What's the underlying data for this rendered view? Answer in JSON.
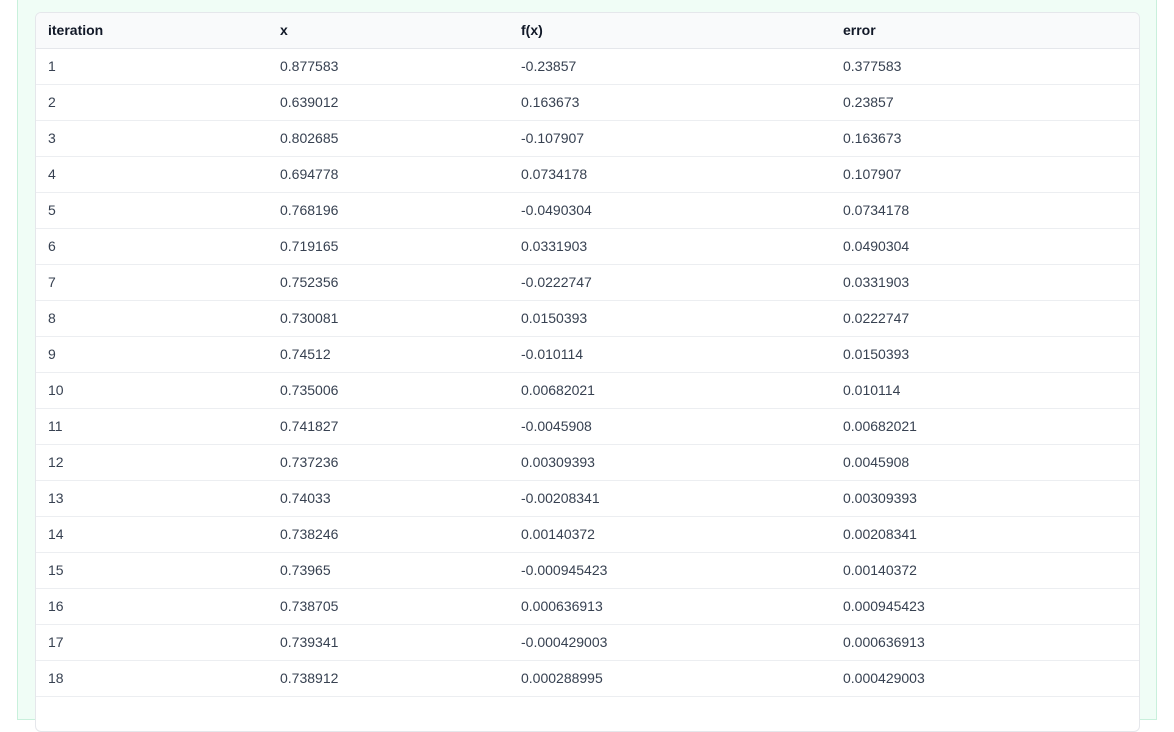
{
  "table": {
    "columns": [
      "iteration",
      "x",
      "f(x)",
      "error"
    ],
    "rows": [
      [
        "1",
        "0.877583",
        "-0.23857",
        "0.377583"
      ],
      [
        "2",
        "0.639012",
        "0.163673",
        "0.23857"
      ],
      [
        "3",
        "0.802685",
        "-0.107907",
        "0.163673"
      ],
      [
        "4",
        "0.694778",
        "0.0734178",
        "0.107907"
      ],
      [
        "5",
        "0.768196",
        "-0.0490304",
        "0.0734178"
      ],
      [
        "6",
        "0.719165",
        "0.0331903",
        "0.0490304"
      ],
      [
        "7",
        "0.752356",
        "-0.0222747",
        "0.0331903"
      ],
      [
        "8",
        "0.730081",
        "0.0150393",
        "0.0222747"
      ],
      [
        "9",
        "0.74512",
        "-0.010114",
        "0.0150393"
      ],
      [
        "10",
        "0.735006",
        "0.00682021",
        "0.010114"
      ],
      [
        "11",
        "0.741827",
        "-0.0045908",
        "0.00682021"
      ],
      [
        "12",
        "0.737236",
        "0.00309393",
        "0.0045908"
      ],
      [
        "13",
        "0.74033",
        "-0.00208341",
        "0.00309393"
      ],
      [
        "14",
        "0.738246",
        "0.00140372",
        "0.00208341"
      ],
      [
        "15",
        "0.73965",
        "-0.000945423",
        "0.00140372"
      ],
      [
        "16",
        "0.738705",
        "0.000636913",
        "0.000945423"
      ],
      [
        "17",
        "0.739341",
        "-0.000429003",
        "0.000636913"
      ],
      [
        "18",
        "0.738912",
        "0.000288995",
        "0.000429003"
      ]
    ]
  }
}
